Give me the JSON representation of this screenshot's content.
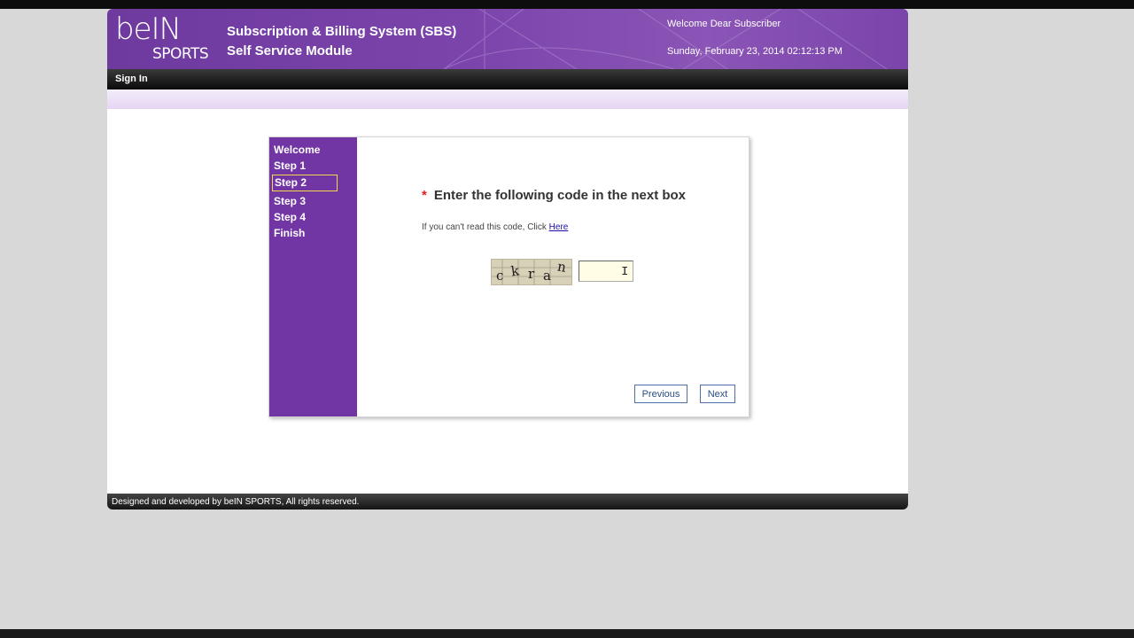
{
  "app": {
    "logo_text": "beIN",
    "logo_sub": "SPORTS",
    "system_line1": "Subscription & Billing System (SBS)",
    "system_line2": "Self Service Module",
    "welcome": "Welcome Dear Subscriber",
    "datetime": "Sunday, February 23, 2014 02:12:13 PM"
  },
  "nav": {
    "signin": "Sign In"
  },
  "wizard": {
    "steps": [
      "Welcome",
      "Step 1",
      "Step 2",
      "Step 3",
      "Step 4",
      "Finish"
    ],
    "active_step": "Step 2",
    "required_marker": "*",
    "question": "Enter the following code in the next box",
    "hint_prefix": "If you can't read this code, Click ",
    "hint_link": "Here",
    "captcha_chars": [
      "c",
      "k",
      "r",
      "a",
      "n"
    ],
    "code_value": "",
    "previous": "Previous",
    "next": "Next"
  },
  "footer": {
    "text": "Designed and developed by beIN SPORTS, All rights reserved."
  },
  "colors": {
    "header": "#7b44ab",
    "steps_panel": "#7236a4",
    "active_step_border": "#f5d84a",
    "required": "#e01e1e",
    "button_text": "#2a4d86"
  }
}
